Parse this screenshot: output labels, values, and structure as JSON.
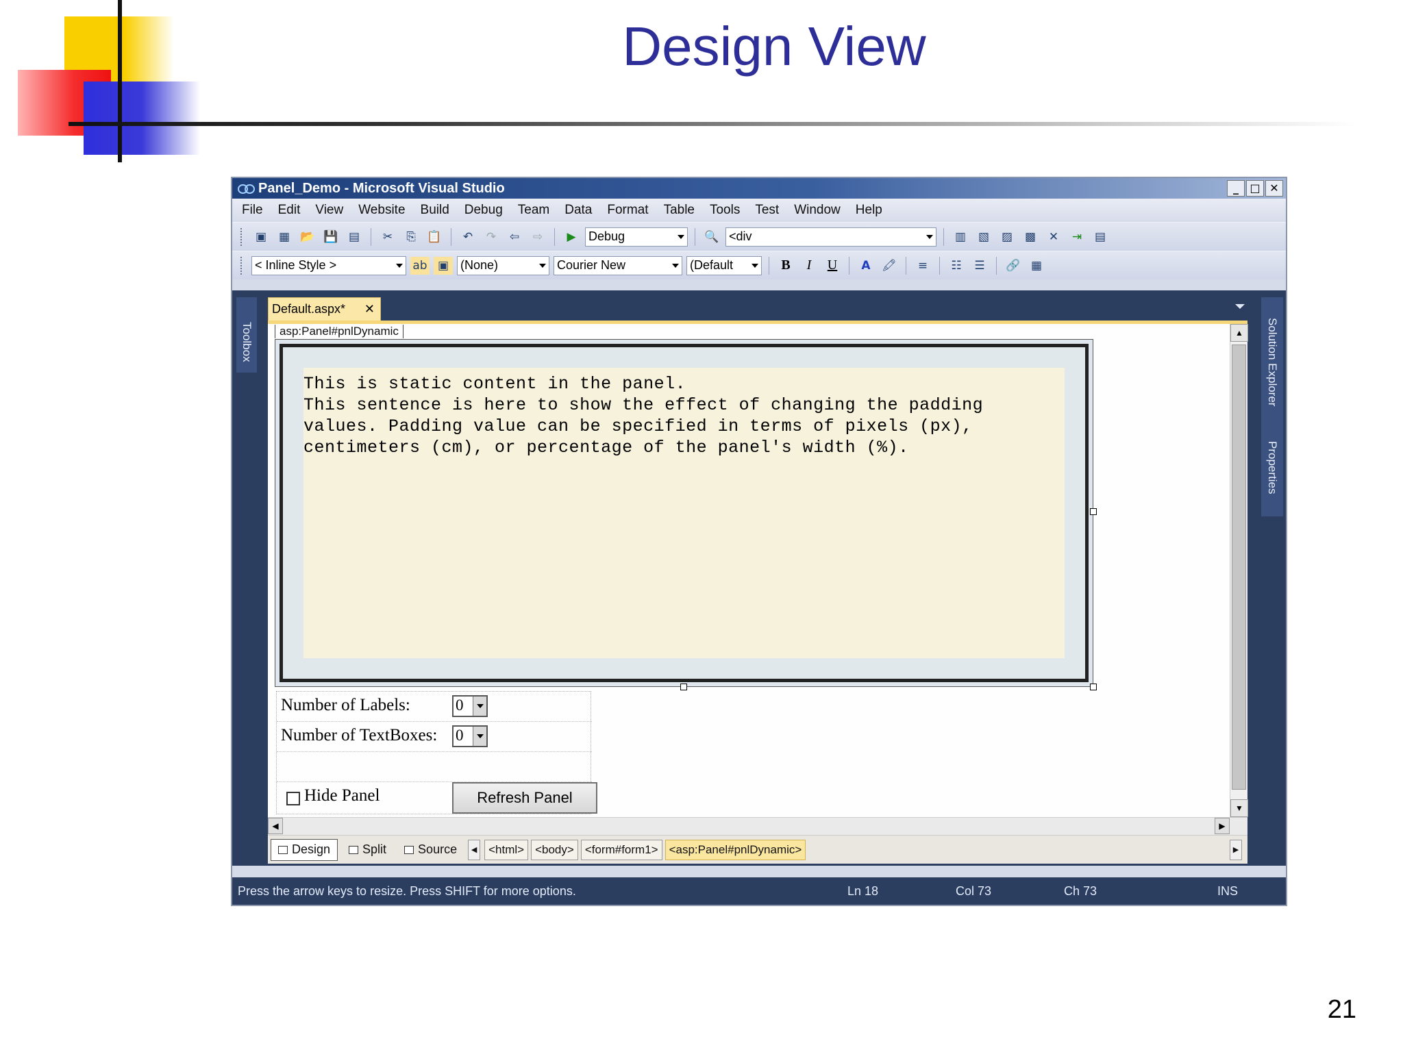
{
  "slide": {
    "title": "Design View",
    "page_number": "21"
  },
  "window": {
    "title": "Panel_Demo - Microsoft Visual Studio",
    "buttons": [
      "_",
      "□",
      "✕"
    ]
  },
  "menu": [
    "File",
    "Edit",
    "View",
    "Website",
    "Build",
    "Debug",
    "Team",
    "Data",
    "Format",
    "Table",
    "Tools",
    "Test",
    "Window",
    "Help"
  ],
  "toolbar1": {
    "config_select": "Debug",
    "target_select": "<div"
  },
  "toolbar2": {
    "style_select": "< Inline Style >",
    "block_format_select": "(None)",
    "font_select": "Courier New",
    "size_select": "(Default",
    "bold": "B",
    "italic": "I",
    "underline": "U"
  },
  "side_panels": {
    "toolbox": "Toolbox",
    "solution_explorer": "Solution Explorer",
    "properties": "Properties"
  },
  "document": {
    "tab_label": "Default.aspx*",
    "tag_label": "asp:Panel#pnlDynamic",
    "panel_lines": [
      "This is static content in the panel.",
      "This sentence is here to show the effect of changing the padding",
      "values. Padding value can be specified in terms of pixels (px),",
      "centimeters (cm), or percentage of the panel's width (%)."
    ],
    "labels_label": "Number of Labels:",
    "labels_value": "0",
    "textboxes_label": "Number of TextBoxes:",
    "textboxes_value": "0",
    "hide_panel_label": "Hide Panel",
    "refresh_button": "Refresh Panel"
  },
  "views": {
    "design": "Design",
    "split": "Split",
    "source": "Source"
  },
  "breadcrumbs": [
    "<html>",
    "<body>",
    "<form#form1>",
    "<asp:Panel#pnlDynamic>"
  ],
  "status": {
    "message": "Press the arrow keys to resize. Press SHIFT for more options.",
    "line": "Ln 18",
    "col": "Col 73",
    "ch": "Ch 73",
    "mode": "INS"
  }
}
